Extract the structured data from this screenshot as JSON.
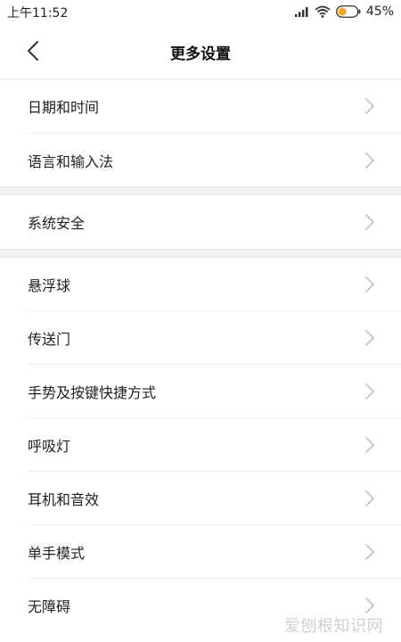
{
  "status_bar": {
    "time": "上午11:52",
    "battery": "45%",
    "battery_level": 0.45,
    "battery_color": "#f5a623"
  },
  "header": {
    "title": "更多设置",
    "back_icon": "chevron-left-icon"
  },
  "sections": [
    {
      "items": [
        {
          "label": "日期和时间"
        },
        {
          "label": "语言和输入法"
        }
      ]
    },
    {
      "items": [
        {
          "label": "系统安全"
        }
      ]
    },
    {
      "items": [
        {
          "label": "悬浮球"
        },
        {
          "label": "传送门"
        },
        {
          "label": "手势及按键快捷方式"
        },
        {
          "label": "呼吸灯"
        },
        {
          "label": "耳机和音效"
        },
        {
          "label": "单手模式"
        },
        {
          "label": "无障碍"
        }
      ]
    }
  ],
  "watermark": "爱刨根知识网"
}
